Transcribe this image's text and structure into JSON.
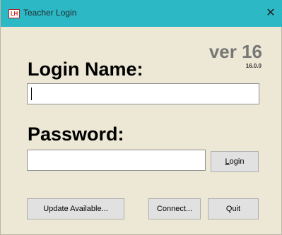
{
  "window": {
    "app_icon_text": "LH",
    "title": "Teacher Login",
    "close_glyph": "✕"
  },
  "header": {
    "version": "ver 16",
    "build": "16.0.0"
  },
  "form": {
    "login_label": "Login Name:",
    "login_value": "",
    "password_label": "Password:",
    "password_value": ""
  },
  "buttons": {
    "login": "Login",
    "update": "Update Available...",
    "connect": "Connect...",
    "quit": "Quit"
  },
  "colors": {
    "titlebar": "#2db8c5",
    "background": "#ece8d5",
    "version_text": "#777776",
    "focus_border": "#0078d7"
  }
}
